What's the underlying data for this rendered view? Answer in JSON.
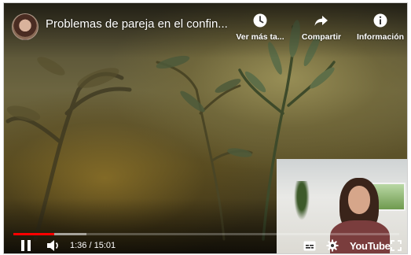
{
  "video": {
    "title": "Problemas de pareja en el confin...",
    "progress_fraction": 0.106,
    "buffered_fraction": 0.19
  },
  "top_actions": [
    {
      "label": "Ver más ta...",
      "icon": "clock-icon"
    },
    {
      "label": "Compartir",
      "icon": "share-icon"
    },
    {
      "label": "Información",
      "icon": "info-icon"
    }
  ],
  "controls": {
    "current_time": "1:36",
    "duration": "15:01",
    "time_display": "1:36 / 15:01",
    "brand": "YouTube"
  },
  "colors": {
    "progress_played": "#ff0000",
    "text": "#ffffff"
  }
}
